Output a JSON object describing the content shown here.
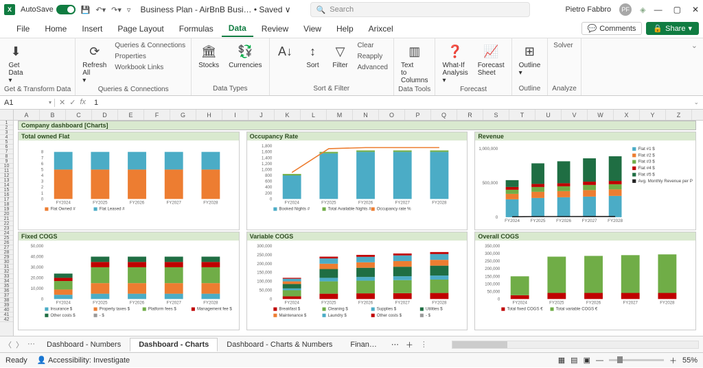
{
  "titlebar": {
    "autosave": "AutoSave",
    "filename": "Business Plan - AirBnB Busi… • Saved ∨",
    "search_placeholder": "Search",
    "user": "Pietro Fabbro",
    "avatar": "PF"
  },
  "menu": [
    "File",
    "Home",
    "Insert",
    "Page Layout",
    "Formulas",
    "Data",
    "Review",
    "View",
    "Help",
    "Arixcel"
  ],
  "menu_active": "Data",
  "comments_btn": "Comments",
  "share_btn": "Share",
  "ribbon": {
    "groups": [
      {
        "label": "Get & Transform Data",
        "btns": [
          {
            "icon": "⬇",
            "text": "Get Data ▾"
          }
        ]
      },
      {
        "label": "Queries & Connections",
        "btns": [
          {
            "icon": "⟳",
            "text": "Refresh All ▾"
          }
        ],
        "small": [
          "Queries & Connections",
          "Properties",
          "Workbook Links"
        ]
      },
      {
        "label": "Data Types",
        "btns": [
          {
            "icon": "🏛",
            "text": "Stocks"
          },
          {
            "icon": "💱",
            "text": "Currencies"
          }
        ]
      },
      {
        "label": "Sort & Filter",
        "btns": [
          {
            "icon": "A↓",
            "text": ""
          },
          {
            "icon": "↕",
            "text": "Sort"
          },
          {
            "icon": "▽",
            "text": "Filter"
          }
        ],
        "small": [
          "Clear",
          "Reapply",
          "Advanced"
        ]
      },
      {
        "label": "Data Tools",
        "btns": [
          {
            "icon": "▥",
            "text": "Text to Columns"
          }
        ]
      },
      {
        "label": "Forecast",
        "btns": [
          {
            "icon": "❓",
            "text": "What-If Analysis ▾"
          },
          {
            "icon": "📈",
            "text": "Forecast Sheet"
          }
        ]
      },
      {
        "label": "Outline",
        "btns": [
          {
            "icon": "⊞",
            "text": "Outline ▾"
          }
        ]
      },
      {
        "label": "Analyze",
        "small": [
          "Solver"
        ]
      }
    ]
  },
  "namebox": "A1",
  "formula": "1",
  "columns": [
    "A",
    "B",
    "C",
    "D",
    "E",
    "F",
    "G",
    "H",
    "I",
    "J",
    "K",
    "L",
    "M",
    "N",
    "O",
    "P",
    "Q",
    "R",
    "S",
    "T",
    "U",
    "V",
    "W",
    "X",
    "Y",
    "Z"
  ],
  "row_count": 42,
  "dash_title": "Company dashboard [Charts]",
  "sheet_tabs": [
    "Dashboard - Numbers",
    "Dashboard - Charts",
    "Dashboard - Charts & Numbers",
    "Finan…"
  ],
  "sheet_active": 1,
  "status_ready": "Ready",
  "status_access": "Accessibility: Investigate",
  "zoom": "55%",
  "chart_data": [
    {
      "type": "bar",
      "title": "Total owned Flat",
      "categories": [
        "FY2024",
        "FY2025",
        "FY2026",
        "FY2027",
        "FY2028"
      ],
      "series": [
        {
          "name": "Flat Owned #",
          "color": "#ed7d31",
          "values": [
            5,
            5,
            5,
            5,
            5
          ]
        },
        {
          "name": "Flat Leased #",
          "color": "#4bacc6",
          "values": [
            3,
            3,
            3,
            3,
            3
          ]
        }
      ],
      "ylim": [
        0,
        9
      ],
      "yticks": [
        0,
        1,
        2,
        3,
        4,
        5,
        6,
        7,
        8
      ]
    },
    {
      "type": "combo",
      "title": "Occupancy Rate",
      "categories": [
        "FY2024",
        "FY2025",
        "FY2026",
        "FY2027",
        "FY2028"
      ],
      "series": [
        {
          "name": "Booked Nights #",
          "color": "#4bacc6",
          "type": "bar",
          "values": [
            800,
            1550,
            1600,
            1600,
            1600
          ]
        },
        {
          "name": "Total Available Nights #",
          "color": "#70ad47",
          "type": "bar",
          "values": [
            50,
            50,
            50,
            50,
            50
          ]
        },
        {
          "name": "Occupancy rate %",
          "color": "#ed7d31",
          "type": "line",
          "values": [
            0.5,
            0.95,
            0.97,
            0.97,
            0.97
          ],
          "axis": "right"
        }
      ],
      "ylim": [
        0,
        1800
      ],
      "yticks": [
        0,
        200,
        400,
        600,
        800,
        1000,
        1200,
        1400,
        1600,
        1800
      ],
      "ylim2": [
        0,
        1
      ]
    },
    {
      "type": "bar",
      "title": "Revenue",
      "categories": [
        "FY2024",
        "FY2025",
        "FY2026",
        "FY2027",
        "FY2028"
      ],
      "series": [
        {
          "name": "Flat #1 $",
          "color": "#4bacc6",
          "values": [
            260000,
            280000,
            290000,
            300000,
            310000
          ]
        },
        {
          "name": "Flat #2 $",
          "color": "#ed7d31",
          "values": [
            80000,
            90000,
            90000,
            95000,
            95000
          ]
        },
        {
          "name": "Flat #3 $",
          "color": "#70ad47",
          "values": [
            60000,
            70000,
            70000,
            75000,
            75000
          ]
        },
        {
          "name": "Flat #4 $",
          "color": "#c00000",
          "values": [
            40000,
            45000,
            45000,
            48000,
            48000
          ]
        },
        {
          "name": "Flat #5 $",
          "color": "#1f6e43",
          "values": [
            100000,
            300000,
            320000,
            340000,
            360000
          ]
        },
        {
          "name": "Avg. Monthly Revenue per Property $",
          "color": "#222",
          "type": "line",
          "values": [
            6000,
            9000,
            9200,
            9400,
            9600
          ]
        }
      ],
      "ylim": [
        0,
        1000000
      ],
      "yticks": [
        0,
        500000,
        1000000
      ]
    },
    {
      "type": "bar",
      "title": "Fixed COGS",
      "categories": [
        "FY2024",
        "FY2025",
        "FY2026",
        "FY2027",
        "FY2028"
      ],
      "series": [
        {
          "name": "Insurance $",
          "color": "#4bacc6",
          "values": [
            4000,
            5000,
            5000,
            5000,
            5000
          ]
        },
        {
          "name": "Property taxes $",
          "color": "#ed7d31",
          "values": [
            5000,
            10000,
            10000,
            10000,
            10000
          ]
        },
        {
          "name": "Platform fees $",
          "color": "#70ad47",
          "values": [
            8000,
            15000,
            15000,
            15000,
            15000
          ]
        },
        {
          "name": "Management fee $",
          "color": "#c00000",
          "values": [
            3000,
            5000,
            5000,
            5000,
            5000
          ]
        },
        {
          "name": "Other costs $",
          "color": "#1f6e43",
          "values": [
            4000,
            5000,
            5000,
            5000,
            5000
          ]
        },
        {
          "name": "- $",
          "color": "#999",
          "values": [
            0,
            0,
            0,
            0,
            0
          ]
        }
      ],
      "ylim": [
        0,
        50000
      ],
      "yticks": [
        0,
        10000,
        20000,
        30000,
        40000,
        50000
      ]
    },
    {
      "type": "bar",
      "title": "Variable COGS",
      "categories": [
        "FY2024",
        "FY2025",
        "FY2026",
        "FY2027",
        "FY2028"
      ],
      "series": [
        {
          "name": "Breakfast $",
          "color": "#c00000",
          "values": [
            15000,
            30000,
            32000,
            33000,
            34000
          ]
        },
        {
          "name": "Cleaning $",
          "color": "#70ad47",
          "values": [
            35000,
            70000,
            72000,
            74000,
            76000
          ]
        },
        {
          "name": "Supplies $",
          "color": "#4bacc6",
          "values": [
            10000,
            20000,
            21000,
            22000,
            23000
          ]
        },
        {
          "name": "Utilities $",
          "color": "#1f6e43",
          "values": [
            25000,
            50000,
            52000,
            54000,
            56000
          ]
        },
        {
          "name": "Maintenance $",
          "color": "#ed7d31",
          "values": [
            15000,
            30000,
            31000,
            32000,
            33000
          ]
        },
        {
          "name": "Laundry $",
          "color": "#4bacc6",
          "values": [
            15000,
            30000,
            31000,
            32000,
            33000
          ]
        },
        {
          "name": "Other costs $",
          "color": "#c00000",
          "values": [
            5000,
            10000,
            11000,
            11000,
            11000
          ]
        },
        {
          "name": "- $",
          "color": "#999",
          "values": [
            0,
            0,
            0,
            0,
            0
          ]
        }
      ],
      "ylim": [
        0,
        300000
      ],
      "yticks": [
        0,
        50000,
        100000,
        150000,
        200000,
        250000,
        300000
      ]
    },
    {
      "type": "bar",
      "title": "Overall COGS",
      "categories": [
        "FY2024",
        "FY2025",
        "FY2026",
        "FY2027",
        "FY2028"
      ],
      "series": [
        {
          "name": "Total fixed COGS €",
          "color": "#c00000",
          "values": [
            25000,
            40000,
            40000,
            40000,
            40000
          ]
        },
        {
          "name": "Total variable COGS €",
          "color": "#70ad47",
          "values": [
            125000,
            240000,
            245000,
            250000,
            255000
          ]
        }
      ],
      "ylim": [
        0,
        350000
      ],
      "yticks": [
        0,
        50000,
        100000,
        150000,
        200000,
        250000,
        300000,
        350000
      ]
    }
  ]
}
